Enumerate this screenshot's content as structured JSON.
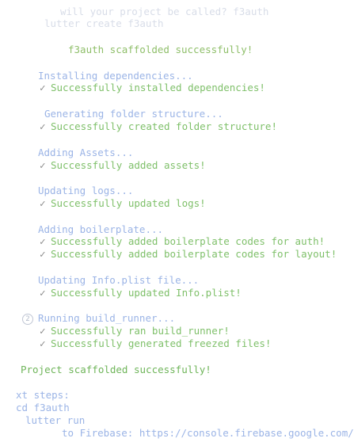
{
  "terminal": {
    "prompt_project": "will your project be called? f3auth",
    "prompt_command": "lutter create f3auth",
    "scaffold_msg": "f3auth scaffolded successfully!",
    "steps": [
      {
        "title": "Installing dependencies...",
        "results": [
          "Successfully installed dependencies!"
        ]
      },
      {
        "title": "Generating folder structure...",
        "results": [
          "Successfully created folder structure!"
        ]
      },
      {
        "title": "Adding Assets...",
        "results": [
          "Successfully added assets!"
        ]
      },
      {
        "title": "Updating logs...",
        "results": [
          "Successfully updated logs!"
        ]
      },
      {
        "title": "Adding boilerplate...",
        "results": [
          "Successfully added boilerplate codes for auth!",
          "Successfully added boilerplate codes for layout!"
        ]
      },
      {
        "title": "Updating Info.plist file...",
        "results": [
          "Successfully updated Info.plist!"
        ]
      },
      {
        "title": "Running build_runner...",
        "step_number": "2",
        "results": [
          "Successfully ran build_runner!",
          "Successfully generated freezed files!"
        ]
      }
    ],
    "final_msg": "Project scaffolded successfully!",
    "next_steps_label": "xt steps:",
    "next_steps": [
      "cd f3auth",
      "lutter run",
      "to Firebase: https://console.firebase.google.com/"
    ],
    "check_glyph": "✓"
  }
}
